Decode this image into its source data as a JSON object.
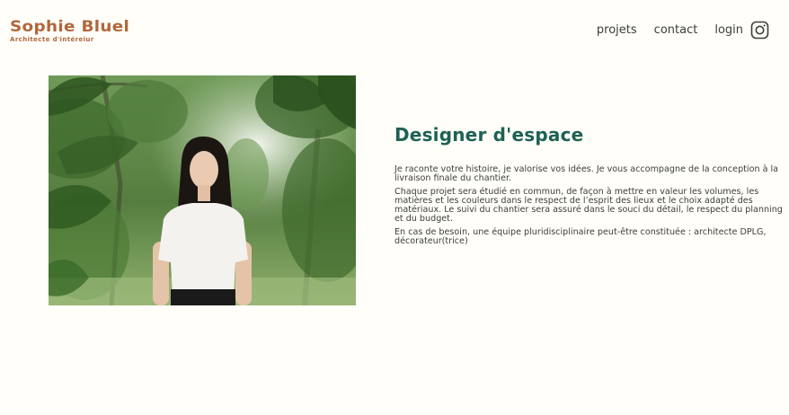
{
  "header": {
    "brand_name": "Sophie Bluel",
    "brand_subtitle": "Architecte d'intéreiur",
    "nav": {
      "projects_label": "projets",
      "contact_label": "contact",
      "login_label": "login",
      "instagram_icon": "instagram-icon"
    }
  },
  "introduction": {
    "title": "Designer d'espace",
    "paragraphs": [
      "Je raconte votre histoire, je valorise vos idées. Je vous accompagne de la conception à la livraison finale du chantier.",
      "Chaque projet sera étudié en commun, de façon à mettre en valeur les volumes, les matières et les couleurs dans le respect de l’esprit des lieux et le choix adapté des matériaux. Le suivi du chantier sera assuré dans le souci du détail, le respect du planning et du budget.",
      "En cas de besoin, une équipe pluridisciplinaire peut-être constituée : architecte DPLG, décorateur(trice)"
    ]
  },
  "colors": {
    "brand": "#b1663c",
    "title": "#1d6154",
    "text": "#3d3d3d",
    "background": "#fffef8"
  }
}
